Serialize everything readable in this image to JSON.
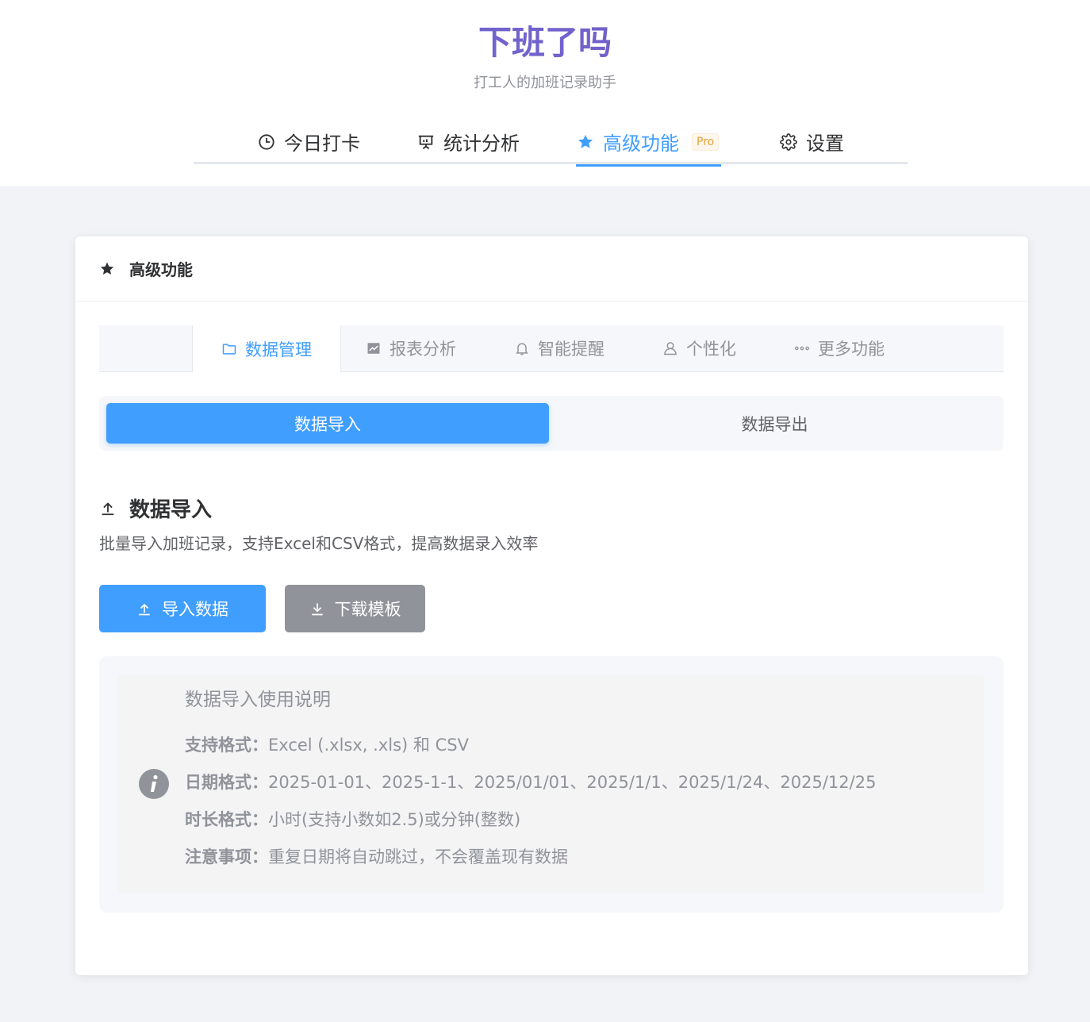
{
  "app": {
    "title": "下班了吗",
    "subtitle": "打工人的加班记录助手"
  },
  "main_nav": {
    "items": [
      {
        "label": "今日打卡",
        "icon": "clock-icon"
      },
      {
        "label": "统计分析",
        "icon": "presentation-chart-icon"
      },
      {
        "label": "高级功能",
        "icon": "star-icon",
        "active": true,
        "badge": "Pro"
      },
      {
        "label": "设置",
        "icon": "gear-icon"
      }
    ]
  },
  "card": {
    "title": "高级功能",
    "icon": "star-icon"
  },
  "sub_tabs": [
    {
      "label": "数据管理",
      "icon": "folder-icon",
      "active": true
    },
    {
      "label": "报表分析",
      "icon": "line-chart-icon"
    },
    {
      "label": "智能提醒",
      "icon": "bell-icon"
    },
    {
      "label": "个性化",
      "icon": "user-icon"
    },
    {
      "label": "更多功能",
      "icon": "more-dots-icon"
    }
  ],
  "segment": {
    "import_label": "数据导入",
    "export_label": "数据导出",
    "selected": "数据导入"
  },
  "section": {
    "title": "数据导入",
    "description": "批量导入加班记录，支持Excel和CSV格式，提高数据录入效率"
  },
  "buttons": {
    "import_label": "导入数据",
    "template_label": "下载模板"
  },
  "info": {
    "title": "数据导入使用说明",
    "lines": [
      {
        "label": "支持格式：",
        "value": "Excel (.xlsx, .xls) 和 CSV"
      },
      {
        "label": "日期格式：",
        "value": "2025-01-01、2025-1-1、2025/01/01、2025/1/1、2025/1/24、2025/12/25"
      },
      {
        "label": "时长格式：",
        "value": "小时(支持小数如2.5)或分钟(整数)"
      },
      {
        "label": "注意事项：",
        "value": "重复日期将自动跳过，不会覆盖现有数据"
      }
    ]
  },
  "colors": {
    "primary": "#409eff",
    "title_gradient_start": "#6a6fd8",
    "title_gradient_end": "#7a55c0",
    "pro_badge": "#e6a23c",
    "secondary_button": "#909399"
  }
}
